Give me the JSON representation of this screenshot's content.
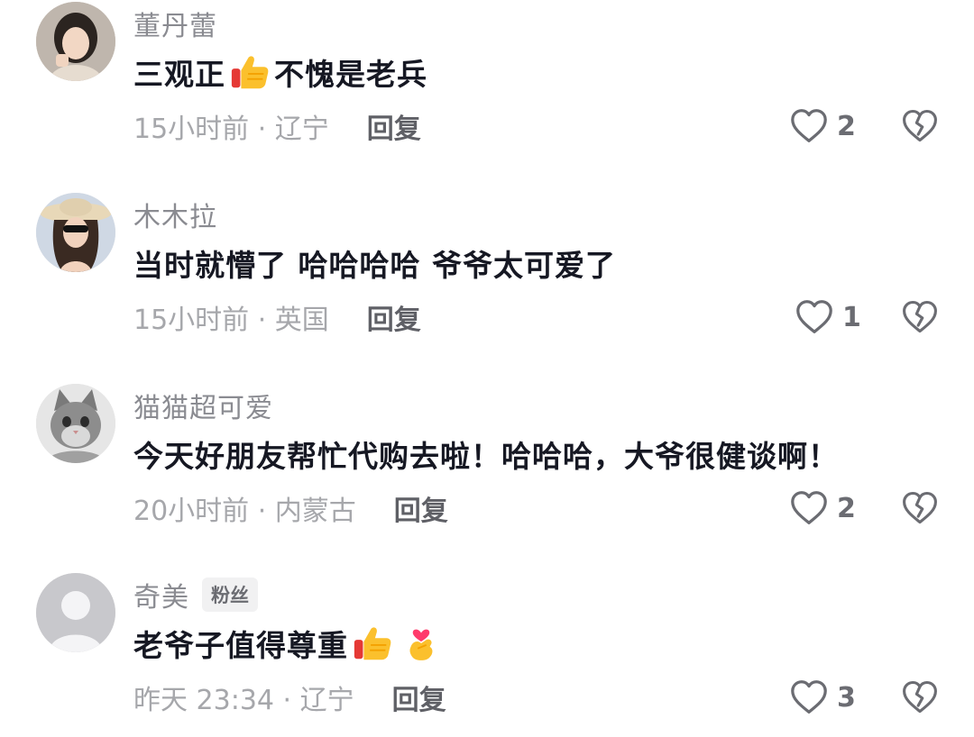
{
  "comments": [
    {
      "username": "董丹蕾",
      "badge": "",
      "text_before": "三观正",
      "emoji_1": "thumbs-up",
      "text_after": "不愧是老兵",
      "time": "15小时前 · 辽宁",
      "reply_label": "回复",
      "likes": "2",
      "avatar": "woman-portrait"
    },
    {
      "username": "木木拉",
      "badge": "",
      "text": "当时就懵了 哈哈哈哈 爷爷太可爱了",
      "time": "15小时前 · 英国",
      "reply_label": "回复",
      "likes": "1",
      "avatar": "woman-with-sunhat"
    },
    {
      "username": "猫猫超可爱",
      "badge": "",
      "text": "今天好朋友帮忙代购去啦！哈哈哈，大爷很健谈啊！",
      "time": "20小时前 · 内蒙古",
      "reply_label": "回复",
      "likes": "2",
      "avatar": "kitten"
    },
    {
      "username": "奇美",
      "badge": "粉丝",
      "text_before": "老爷子值得尊重",
      "emoji_1": "thumbs-up",
      "emoji_2": "finger-heart",
      "time": "昨天 23:34 · 辽宁",
      "reply_label": "回复",
      "likes": "3",
      "avatar": "default-avatar"
    }
  ],
  "colors": {
    "text_primary": "#161823",
    "text_secondary": "#8a8b91",
    "meta": "#a6a7ab",
    "icon": "#6b6c72"
  }
}
